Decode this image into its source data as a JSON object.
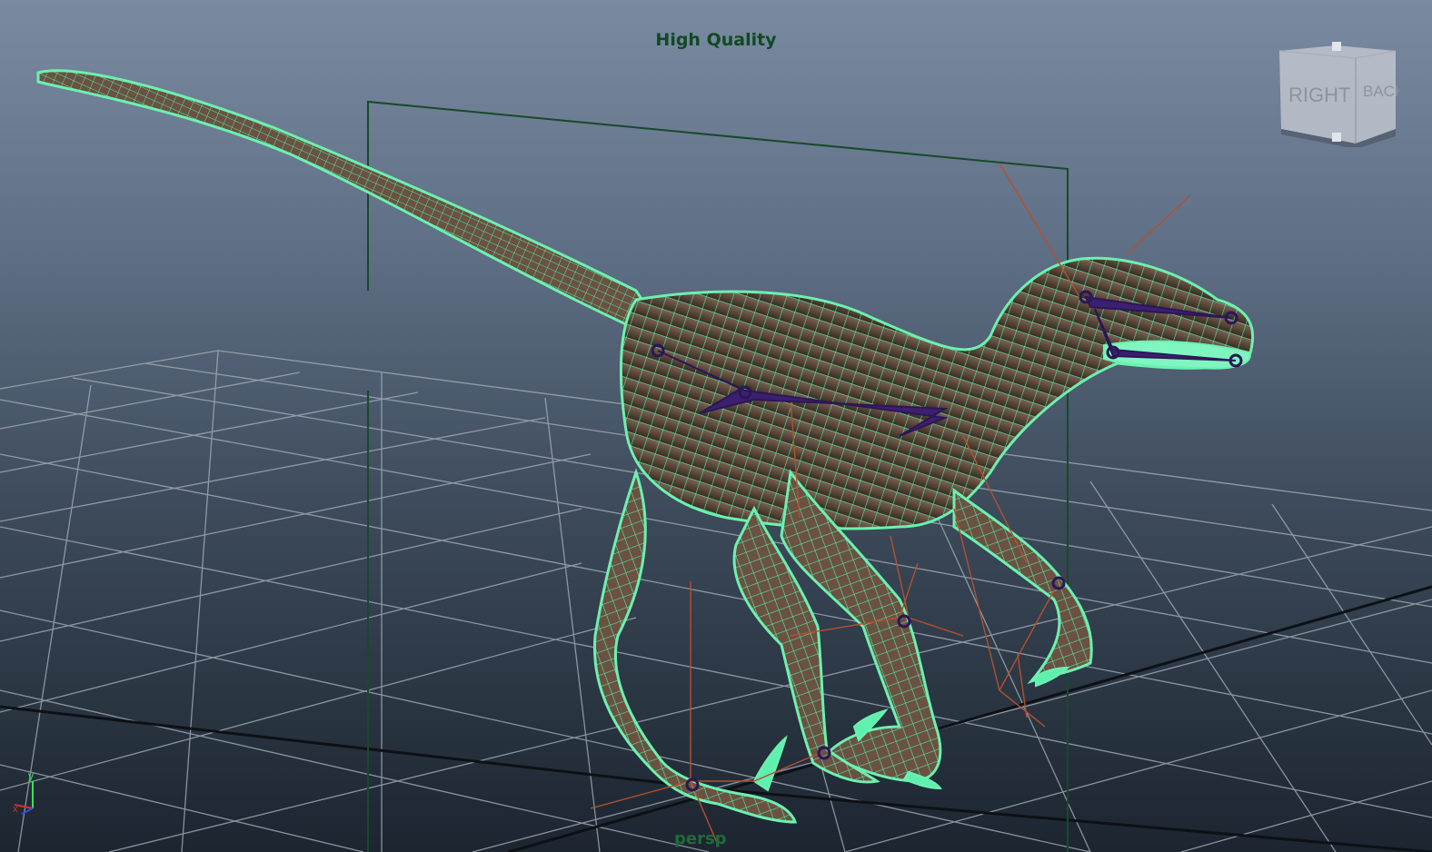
{
  "viewport": {
    "hud_title": "High Quality",
    "camera_name": "persp"
  },
  "view_cube": {
    "face_front": "RIGHT",
    "face_side": "BACK"
  },
  "axis_indicator": {
    "y_label": "y",
    "x_label": "x"
  },
  "colors": {
    "wireframe": "#6df0b0",
    "joint": "#2c1656",
    "skin": "#6f5443",
    "grid": "#9aa4b0",
    "hud_text": "#0f4a23"
  }
}
